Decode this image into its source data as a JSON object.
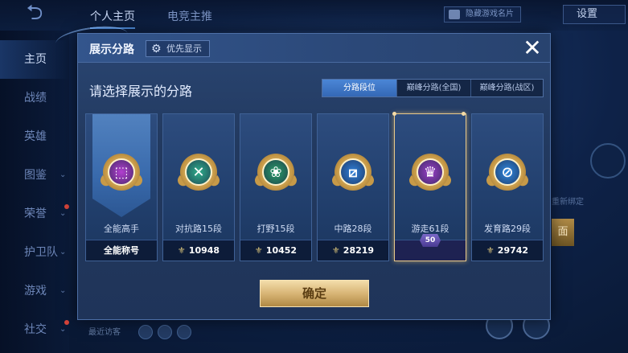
{
  "background": {
    "top_tabs": [
      "个人主页",
      "电竞主推"
    ],
    "card_button": "隐藏游戏名片",
    "settings": "设置",
    "side_nav": [
      {
        "label": "主页",
        "active": true,
        "chevron": false,
        "reddot": false
      },
      {
        "label": "战绩",
        "active": false,
        "chevron": false,
        "reddot": false
      },
      {
        "label": "英雄",
        "active": false,
        "chevron": false,
        "reddot": false
      },
      {
        "label": "图鉴",
        "active": false,
        "chevron": true,
        "reddot": false
      },
      {
        "label": "荣誉",
        "active": false,
        "chevron": true,
        "reddot": true
      },
      {
        "label": "护卫队",
        "active": false,
        "chevron": true,
        "reddot": false
      },
      {
        "label": "游戏",
        "active": false,
        "chevron": true,
        "reddot": false
      },
      {
        "label": "社交",
        "active": false,
        "chevron": true,
        "reddot": true
      }
    ],
    "visitors_label": "最近访客",
    "right_text": "重新绑定",
    "right_gold": "面"
  },
  "modal": {
    "title": "展示分路",
    "priority_button": "优先显示",
    "close_icon": "close-icon",
    "subtitle": "请选择展示的分路",
    "tabs": [
      {
        "label": "分路段位",
        "active": true
      },
      {
        "label": "巅峰分路(全国)",
        "active": false
      },
      {
        "label": "巅峰分路(战区)",
        "active": false
      }
    ],
    "cards": [
      {
        "name": "全能高手",
        "bottom": "全能称号",
        "points": null,
        "color": "#b23fd0",
        "glyph": "⬚",
        "selected": false,
        "banner": true
      },
      {
        "name": "对抗路15段",
        "bottom": "10948",
        "points": true,
        "color": "#2fae8c",
        "glyph": "✕",
        "selected": false,
        "banner": false
      },
      {
        "name": "打野15段",
        "bottom": "10452",
        "points": true,
        "color": "#2a9c6a",
        "glyph": "❀",
        "selected": false,
        "banner": false
      },
      {
        "name": "中路28段",
        "bottom": "28219",
        "points": true,
        "color": "#2f7fd8",
        "glyph": "⧄",
        "selected": false,
        "banner": false
      },
      {
        "name": "游走61段",
        "bottom": "",
        "points": false,
        "color": "#9a3fc8",
        "glyph": "♛",
        "selected": true,
        "banner": false,
        "badge": "50"
      },
      {
        "name": "发育路29段",
        "bottom": "29742",
        "points": true,
        "color": "#2f88e0",
        "glyph": "⊘",
        "selected": false,
        "banner": false
      }
    ],
    "confirm": "确定"
  }
}
